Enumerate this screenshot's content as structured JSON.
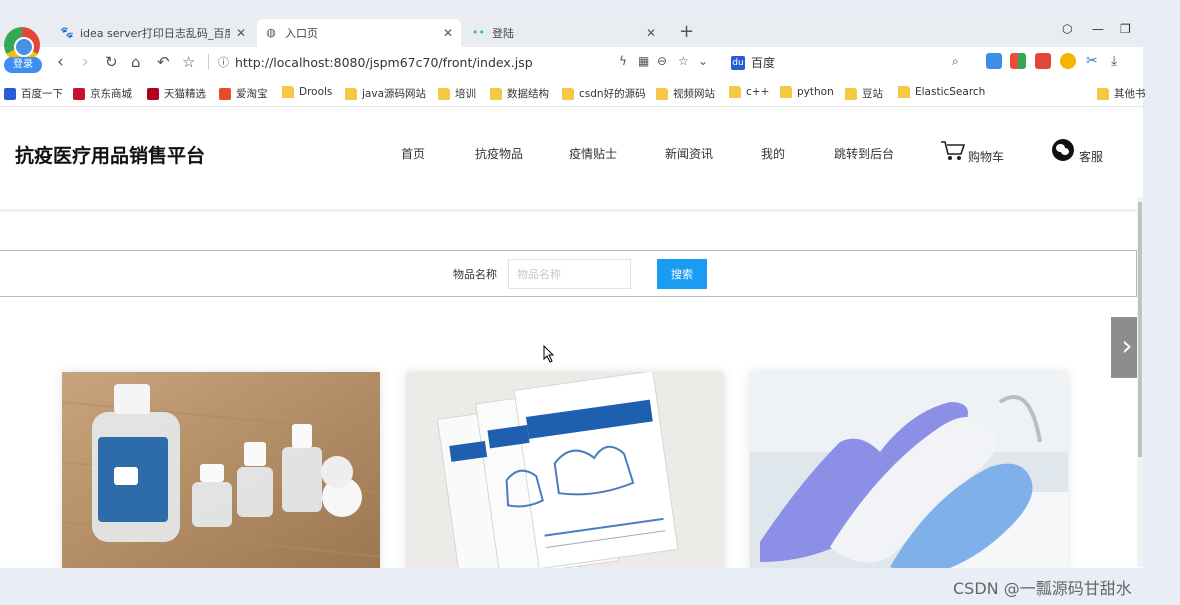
{
  "browser": {
    "profile_label": "登录",
    "tabs": [
      {
        "title": "idea server打印日志乱码_百度搜",
        "icon": "paw-icon"
      },
      {
        "title": "入口页",
        "icon": "globe-icon"
      },
      {
        "title": "登陆",
        "icon": "dots-icon"
      }
    ],
    "url": "http://localhost:8080/jspm67c70/front/index.jsp",
    "search_engine": "百度",
    "bookmarks": [
      "百度一下",
      "京东商城",
      "天猫精选",
      "爱淘宝",
      "Drools",
      "java源码网站",
      "培训",
      "数据结构",
      "csdn好的源码",
      "视频网站",
      "c++",
      "python",
      "豆站",
      "ElasticSearch",
      "其他书"
    ]
  },
  "site": {
    "title": "抗疫医疗用品销售平台",
    "nav": [
      "首页",
      "抗疫物品",
      "疫情贴士",
      "新闻资讯",
      "我的",
      "跳转到后台"
    ],
    "cart_label": "购物车",
    "service_label": "客服"
  },
  "search": {
    "label": "物品名称",
    "placeholder": "物品名称",
    "value": "",
    "button": "搜索"
  },
  "products": [
    {
      "image": "sanitizer-bottles"
    },
    {
      "image": "sterile-gloves-packs"
    },
    {
      "image": "nitrile-gloves"
    }
  ],
  "carousel": {
    "next_icon": "chevron-right-icon"
  },
  "watermark": "CSDN @一瓢源码甘甜水"
}
